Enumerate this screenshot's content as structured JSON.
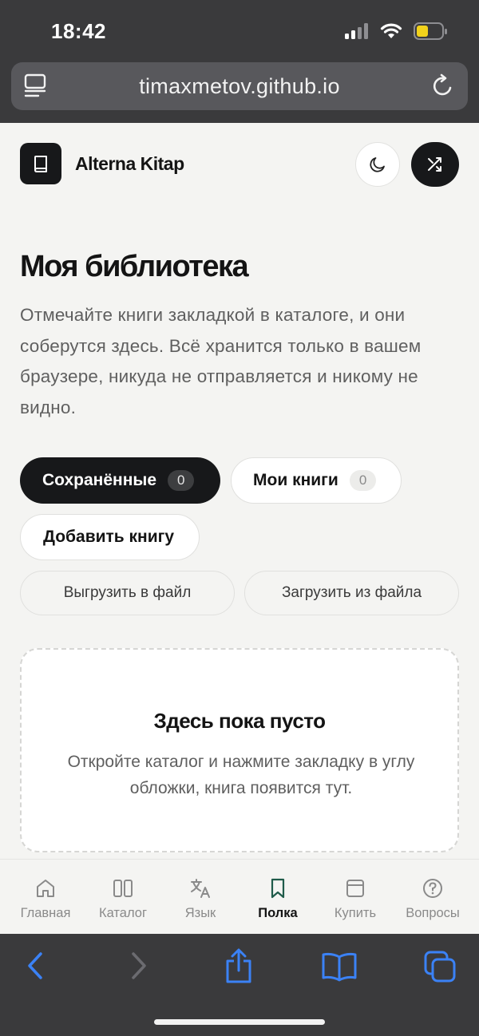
{
  "status_bar": {
    "time": "18:42"
  },
  "browser": {
    "url": "timaxmetov.github.io"
  },
  "header": {
    "brand": "Alterna Kitap"
  },
  "page": {
    "title": "Моя библиотека",
    "description": "Отмечайте книги закладкой в каталоге, и они соберутся здесь. Всё хранится только в вашем браузере, никуда не отправляется и никому не видно."
  },
  "tabs": [
    {
      "label": "Сохранённые",
      "count": "0",
      "active": true
    },
    {
      "label": "Мои книги",
      "count": "0",
      "active": false
    }
  ],
  "add_book_label": "Добавить книгу",
  "file_actions": {
    "export_label": "Выгрузить в файл",
    "import_label": "Загрузить из файла"
  },
  "empty_state": {
    "title": "Здесь пока пусто",
    "text": "Откройте каталог и нажмите закладку в углу обложки, книга появится тут."
  },
  "bottom_nav": [
    {
      "label": "Главная",
      "icon": "home-icon"
    },
    {
      "label": "Каталог",
      "icon": "columns-icon"
    },
    {
      "label": "Язык",
      "icon": "translate-icon"
    },
    {
      "label": "Полка",
      "icon": "bookmark-icon",
      "active": true
    },
    {
      "label": "Купить",
      "icon": "card-icon"
    },
    {
      "label": "Вопросы",
      "icon": "help-icon"
    }
  ],
  "colors": {
    "accent": "#17181a",
    "active_nav_icon": "#1f5b4a",
    "safari_blue": "#3b82f6",
    "background": "#f4f4f2"
  }
}
